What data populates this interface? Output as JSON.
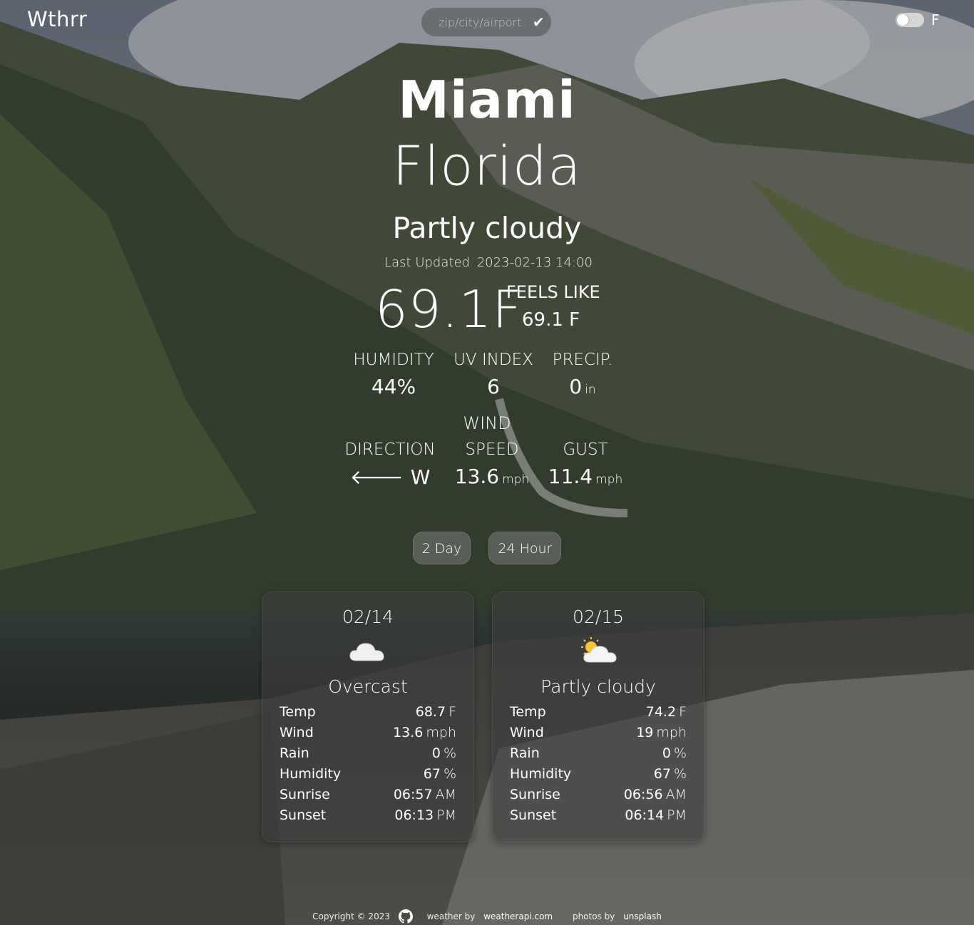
{
  "header": {
    "brand": "Wthrr",
    "search_placeholder": "zip/city/airport",
    "unit_label": "F"
  },
  "current": {
    "city": "Miami",
    "region": "Florida",
    "condition": "Partly cloudy",
    "updated_label": "Last Updated",
    "updated_time": "2023-02-13 14:00",
    "temp": "69.1F",
    "feels_like_label": "FEELS LIKE",
    "feels_like_value": "69.1 F",
    "humidity_label": "HUMIDITY",
    "humidity_value": "44%",
    "uv_label": "UV INDEX",
    "uv_value": "6",
    "precip_label": "PRECIP.",
    "precip_value": "0",
    "precip_unit": "in",
    "wind_title": "WIND",
    "direction_label": "DIRECTION",
    "direction_value": "W",
    "speed_label": "SPEED",
    "speed_value": "13.6",
    "speed_unit": "mph",
    "gust_label": "GUST",
    "gust_value": "11.4",
    "gust_unit": "mph"
  },
  "tabs": [
    "2 Day",
    "24 Hour"
  ],
  "forecast": [
    {
      "date": "02/14",
      "icon": "cloud-icon",
      "condition": "Overcast",
      "rows": [
        {
          "label": "Temp",
          "value": "68.7",
          "unit": "F"
        },
        {
          "label": "Wind",
          "value": "13.6",
          "unit": "mph"
        },
        {
          "label": "Rain",
          "value": "0",
          "unit": "%"
        },
        {
          "label": "Humidity",
          "value": "67",
          "unit": "%"
        },
        {
          "label": "Sunrise",
          "value": "06:57",
          "unit": "AM"
        },
        {
          "label": "Sunset",
          "value": "06:13",
          "unit": "PM"
        }
      ]
    },
    {
      "date": "02/15",
      "icon": "partly-cloudy-icon",
      "condition": "Partly cloudy",
      "rows": [
        {
          "label": "Temp",
          "value": "74.2",
          "unit": "F"
        },
        {
          "label": "Wind",
          "value": "19",
          "unit": "mph"
        },
        {
          "label": "Rain",
          "value": "0",
          "unit": "%"
        },
        {
          "label": "Humidity",
          "value": "67",
          "unit": "%"
        },
        {
          "label": "Sunrise",
          "value": "06:56",
          "unit": "AM"
        },
        {
          "label": "Sunset",
          "value": "06:14",
          "unit": "PM"
        }
      ]
    }
  ],
  "footer": {
    "copyright": "Copyright © 2023",
    "weather_prefix": "weather by",
    "weather_link": "weatherapi.com",
    "photos_prefix": "photos by",
    "photos_link": "unsplash"
  },
  "colors": {
    "card_bg": "#3c3c3c",
    "tab_bg": "#787878",
    "text": "#ffffff"
  }
}
